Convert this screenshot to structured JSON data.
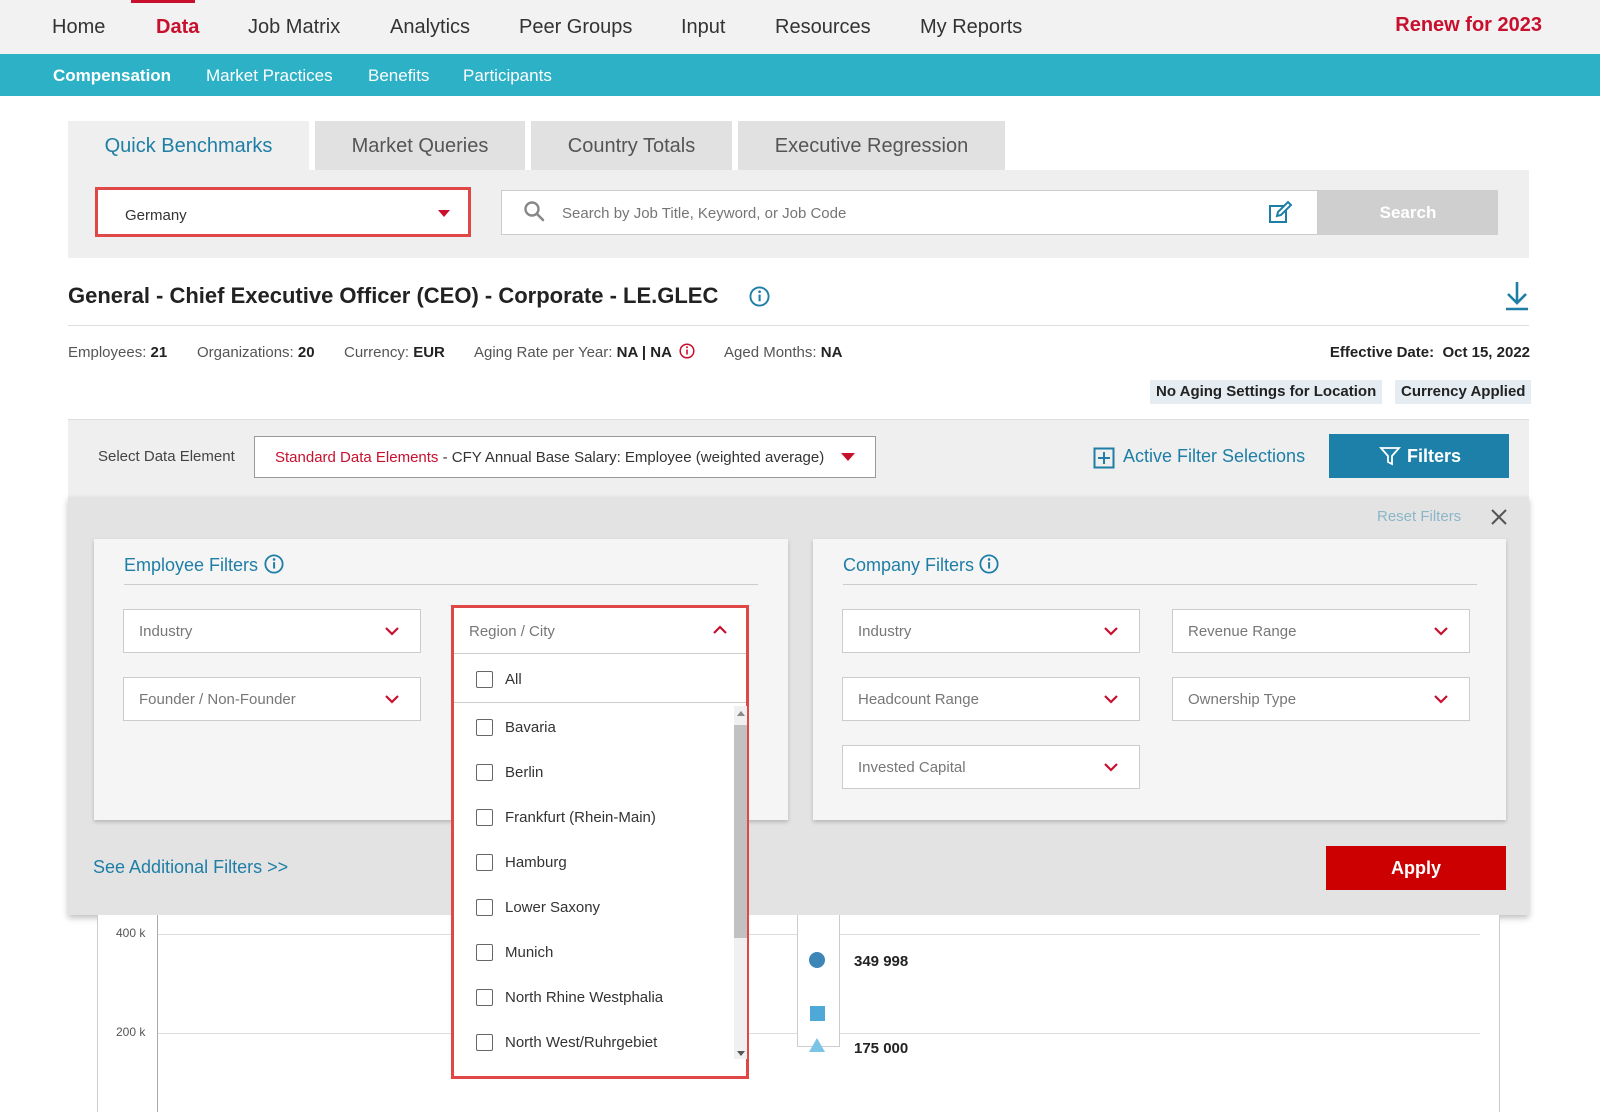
{
  "topnav": {
    "items": [
      "Home",
      "Data",
      "Job Matrix",
      "Analytics",
      "Peer Groups",
      "Input",
      "Resources",
      "My Reports"
    ],
    "renew": "Renew for 2023"
  },
  "subnav": {
    "items": [
      "Compensation",
      "Market Practices",
      "Benefits",
      "Participants"
    ]
  },
  "tabs": [
    "Quick Benchmarks",
    "Market Queries",
    "Country Totals",
    "Executive Regression"
  ],
  "country": "Germany",
  "search": {
    "placeholder": "Search by Job Title, Keyword, or Job Code",
    "button": "Search"
  },
  "job": {
    "title": "General - Chief Executive Officer (CEO) - Corporate - LE.GLEC",
    "employees_label": "Employees:",
    "employees": "21",
    "organizations_label": "Organizations:",
    "organizations": "20",
    "currency_label": "Currency:",
    "currency": "EUR",
    "aging_label": "Aging Rate per Year:",
    "aging": "NA | NA",
    "aged_label": "Aged Months:",
    "aged": "NA",
    "effective_label": "Effective Date:",
    "effective": "Oct 15, 2022",
    "badges": [
      "No Aging Settings for Location",
      "Currency Applied"
    ]
  },
  "data_element": {
    "label": "Select Data Element",
    "prefix": "Standard Data Elements",
    "value": " - CFY Annual Base Salary: Employee (weighted average)"
  },
  "active_filters": "Active Filter Selections",
  "filters_button": "Filters",
  "reset_filters": "Reset Filters",
  "employee_filters": {
    "title": "Employee Filters",
    "dropdowns": [
      "Industry",
      "Founder / Non-Founder",
      "Region / City"
    ]
  },
  "company_filters": {
    "title": "Company Filters",
    "dropdowns": [
      "Industry",
      "Revenue Range",
      "Headcount Range",
      "Ownership Type",
      "Invested Capital"
    ]
  },
  "region_options": [
    "All",
    "Bavaria",
    "Berlin",
    "Frankfurt (Rhein-Main)",
    "Hamburg",
    "Lower Saxony",
    "Munich",
    "North Rhine Westphalia",
    "North West/Ruhrgebiet"
  ],
  "see_additional": "See Additional Filters >>",
  "apply": "Apply",
  "chart": {
    "yticks": [
      "400 k",
      "200 k"
    ],
    "values": [
      "349 998",
      "175 000"
    ],
    "colors": {
      "circle": "#3d86b8",
      "square": "#4ea9d8",
      "triangle": "#7cc4e6"
    }
  }
}
